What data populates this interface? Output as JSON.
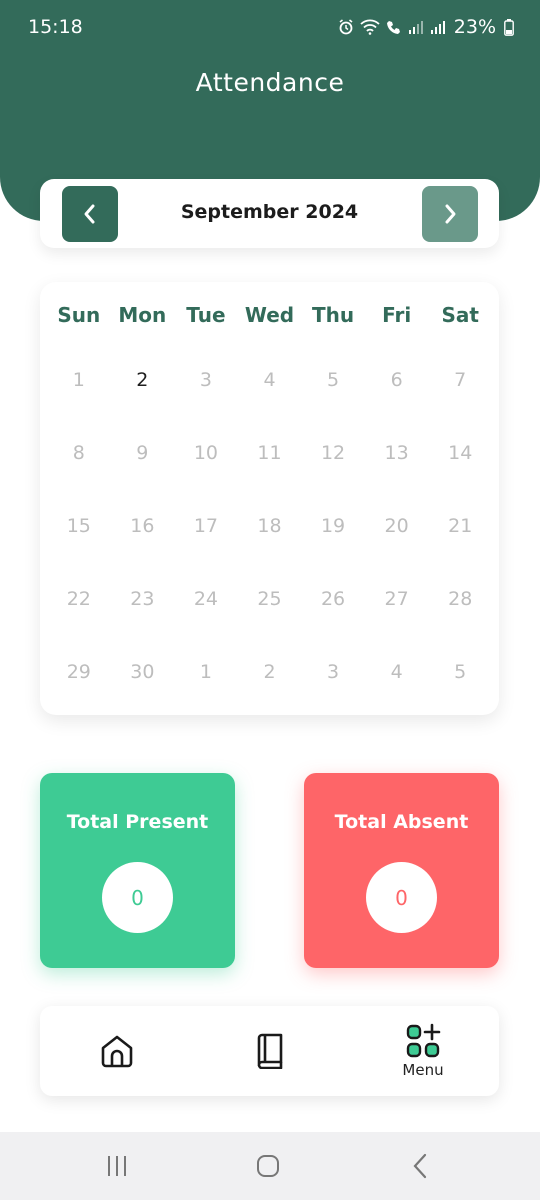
{
  "status_bar": {
    "time": "15:18",
    "battery": "23%"
  },
  "header": {
    "title": "Attendance"
  },
  "month_nav": {
    "month_label": "September 2024"
  },
  "calendar": {
    "weekdays": [
      "Sun",
      "Mon",
      "Tue",
      "Wed",
      "Thu",
      "Fri",
      "Sat"
    ],
    "weeks": [
      [
        "1",
        "2",
        "3",
        "4",
        "5",
        "6",
        "7"
      ],
      [
        "8",
        "9",
        "10",
        "11",
        "12",
        "13",
        "14"
      ],
      [
        "15",
        "16",
        "17",
        "18",
        "19",
        "20",
        "21"
      ],
      [
        "22",
        "23",
        "24",
        "25",
        "26",
        "27",
        "28"
      ],
      [
        "29",
        "30",
        "1",
        "2",
        "3",
        "4",
        "5"
      ]
    ],
    "highlighted_day": "2"
  },
  "stats": {
    "present_label": "Total Present",
    "present_value": "0",
    "absent_label": "Total Absent",
    "absent_value": "0"
  },
  "bottom_nav": {
    "menu_label": "Menu"
  },
  "colors": {
    "brand": "#336b5a",
    "present": "#3ecb94",
    "absent": "#fe6568"
  }
}
